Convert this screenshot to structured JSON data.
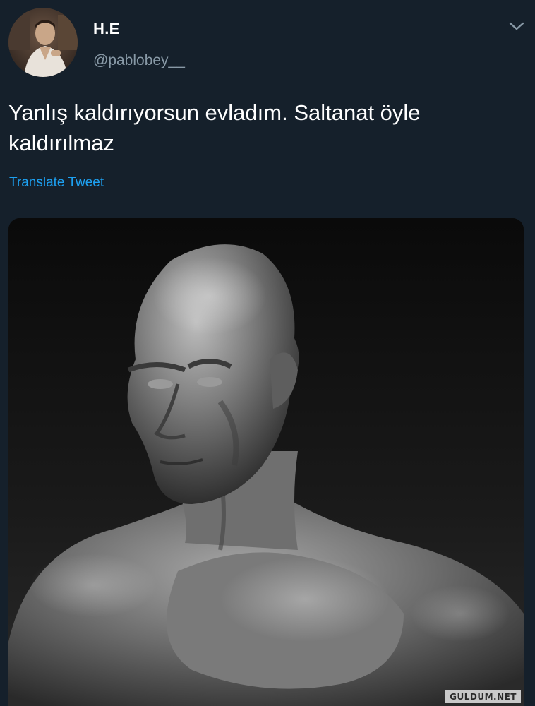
{
  "tweet": {
    "display_name": "H.E",
    "handle": "@pablobey__",
    "text": "Yanlış kaldırıyorsun evladım. Saltanat öyle kaldırılmaz",
    "translate_label": "Translate Tweet"
  },
  "icons": {
    "menu": "chevron-down-icon"
  },
  "media": {
    "description_hidden": true
  },
  "watermark": {
    "text": "GULDUM.NET"
  },
  "colors": {
    "background": "#15202b",
    "link": "#1da1f2",
    "secondary_text": "#8899a6"
  }
}
